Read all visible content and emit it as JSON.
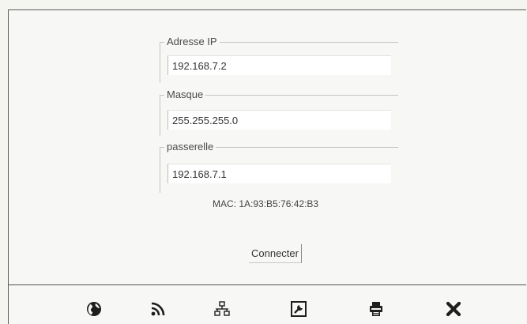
{
  "network": {
    "ip": {
      "label": "Adresse IP",
      "value": "192.168.7.2"
    },
    "mask": {
      "label": "Masque",
      "value": "255.255.255.0"
    },
    "gateway": {
      "label": "passerelle",
      "value": "192.168.7.1"
    },
    "mac_label": "MAC: 1A:93:B5:76:42:B3",
    "connect_label": "Connecter"
  },
  "toolbar": {
    "items": [
      {
        "icon": "globe-icon"
      },
      {
        "icon": "wifi-icon"
      },
      {
        "icon": "network-icon"
      },
      {
        "icon": "wrench-icon"
      },
      {
        "icon": "printer-icon"
      },
      {
        "icon": "close-icon"
      }
    ]
  },
  "colors": {
    "icon": "#1e1e1e",
    "background": "#f7f7f5"
  }
}
